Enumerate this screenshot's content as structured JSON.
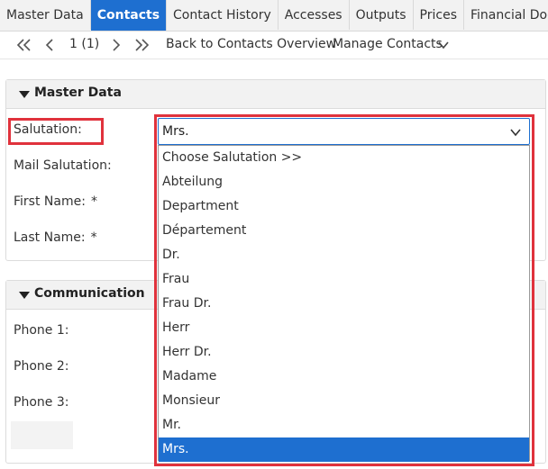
{
  "tabs": [
    {
      "label": "Master Data",
      "active": false
    },
    {
      "label": "Contacts",
      "active": true
    },
    {
      "label": "Contact History",
      "active": false
    },
    {
      "label": "Accesses",
      "active": false
    },
    {
      "label": "Outputs",
      "active": false
    },
    {
      "label": "Prices",
      "active": false
    },
    {
      "label": "Financial Docume",
      "active": false
    }
  ],
  "toolbar": {
    "page_indicator": "1 (1)",
    "back_link": "Back to Contacts Overview",
    "manage_menu": "Manage Contacts",
    "icons": [
      "first-page-icon",
      "prev-page-icon",
      "next-page-icon",
      "last-page-icon",
      "chevron-down-icon"
    ]
  },
  "master_data": {
    "title": "Master Data",
    "salutation_label": "Salutation:",
    "mail_salutation_label": "Mail Salutation:",
    "first_name_label": "First Name:",
    "last_name_label": "Last Name:",
    "required_marker": "*"
  },
  "salutation_select": {
    "value": "Mrs.",
    "options": [
      "Choose Salutation >>",
      "Abteilung",
      "Department",
      "Département",
      "Dr.",
      "Frau",
      "Frau Dr.",
      "Herr",
      "Herr Dr.",
      "Madame",
      "Monsieur",
      "Mr.",
      "Mrs."
    ],
    "selected_index": 12
  },
  "communication": {
    "title": "Communication",
    "phone1_label": "Phone 1:",
    "phone2_label": "Phone 2:",
    "phone3_label": "Phone 3:"
  },
  "colors": {
    "accent": "#1e6fd0",
    "highlight": "#e0323c"
  }
}
